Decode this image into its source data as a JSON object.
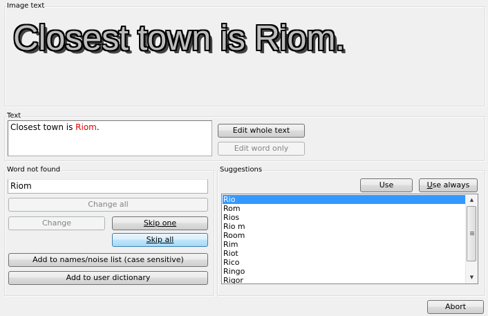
{
  "image_text": {
    "label": "Image text",
    "content": "Closest town is Riom."
  },
  "text_group": {
    "label": "Text",
    "before": "Closest town is ",
    "highlight": "Riom",
    "after": ".",
    "highlight_color": "#e00000",
    "edit_whole_label": "Edit whole text",
    "edit_word_label": "Edit word only"
  },
  "word_group": {
    "label": "Word not found",
    "value": "Riom",
    "change_all_label": "Change all",
    "change_label": "Change",
    "skip_one_label": "Skip one",
    "skip_all_label": "Skip all",
    "add_names_label": "Add to names/noise list (case sensitive)",
    "add_dict_label": "Add to user dictionary"
  },
  "suggestions": {
    "label": "Suggestions",
    "use_label": "Use",
    "use_always_label": "Use always",
    "items": [
      "Rio",
      "Rom",
      "Rios",
      "Rio m",
      "Room",
      "Rim",
      "Riot",
      "Rico",
      "Ringo",
      "Rigor"
    ],
    "selected_index": 0,
    "selection_color": "#3399ff"
  },
  "footer": {
    "abort_label": "Abort"
  }
}
